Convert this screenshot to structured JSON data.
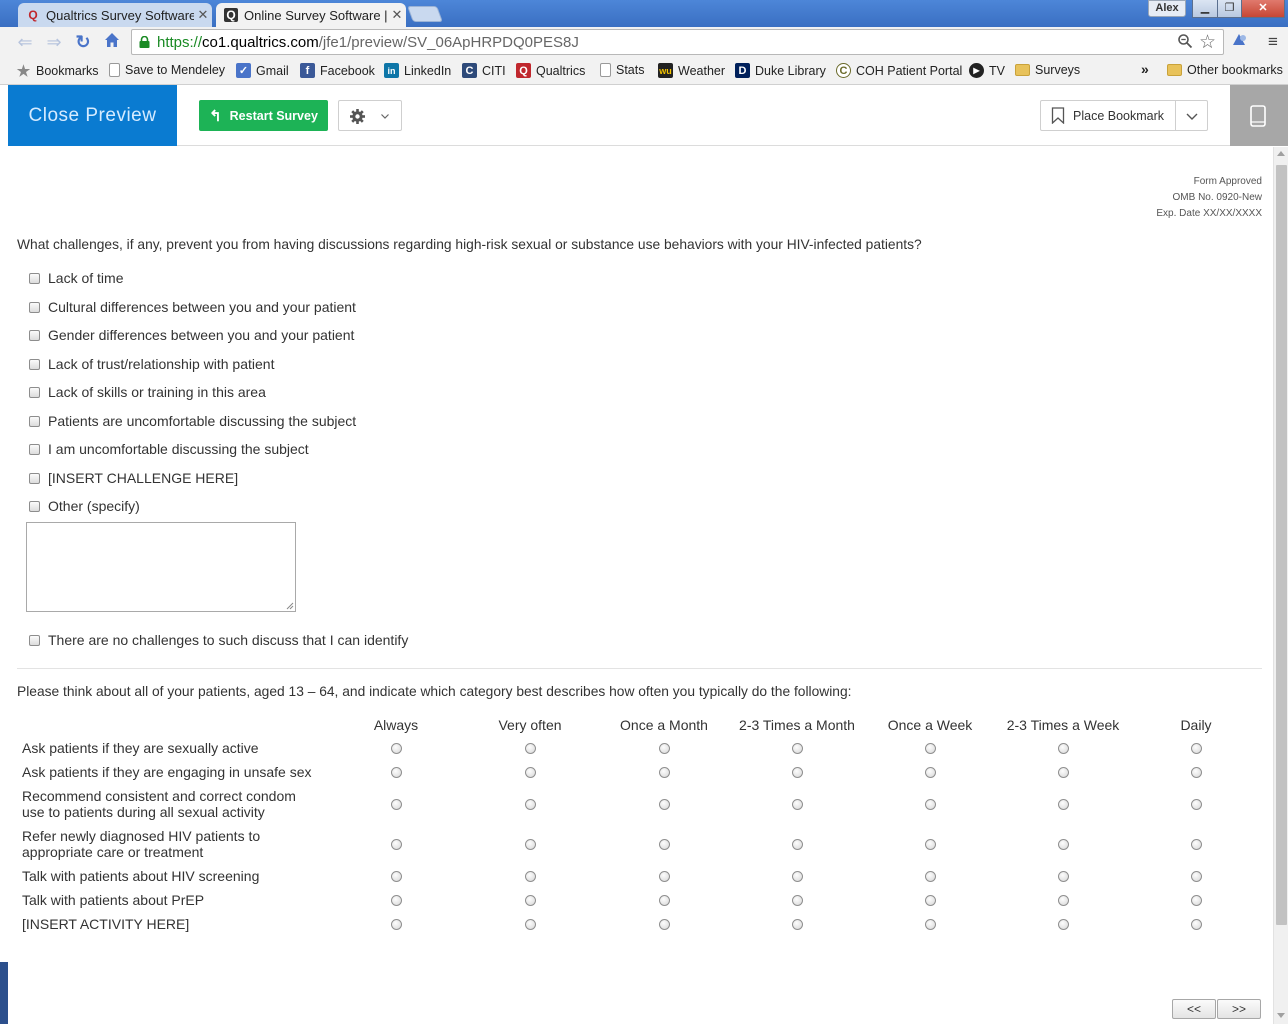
{
  "browser": {
    "tabs": [
      {
        "title": "Qualtrics Survey Software",
        "active": false
      },
      {
        "title": "Online Survey Software | C",
        "active": true
      }
    ],
    "user": "Alex",
    "url": {
      "scheme": "https://",
      "host": "co1.qualtrics.com",
      "path": "/jfe1/preview/SV_06ApHRPDQ0PES8J"
    },
    "bookmarks": [
      "Bookmarks",
      "Save to Mendeley",
      "Gmail",
      "Facebook",
      "LinkedIn",
      "CITI",
      "Qualtrics",
      "Stats",
      "Weather",
      "Duke Library",
      "COH Patient Portal",
      "TV",
      "Surveys"
    ],
    "other_bookmarks": "Other bookmarks",
    "overflow": "»"
  },
  "preview_bar": {
    "close_label": "Close Preview",
    "restart_label": "Restart Survey",
    "bookmark_label": "Place Bookmark"
  },
  "survey": {
    "form_note": [
      "Form Approved",
      "OMB No. 0920-New",
      "Exp. Date XX/XX/XXXX"
    ],
    "q1": {
      "text": "What challenges, if any, prevent you from having discussions regarding high-risk sexual or substance use behaviors with your HIV-infected patients?",
      "choices": [
        "Lack of time",
        "Cultural differences between you and your patient",
        "Gender differences between you and your patient",
        "Lack of trust/relationship with patient",
        "Lack of skills or training in this area",
        "Patients are uncomfortable discussing the subject",
        "I am uncomfortable discussing the subject",
        "[INSERT CHALLENGE HERE]",
        "Other (specify)"
      ],
      "other_value": "",
      "none_choice": "There are no challenges to such discuss that I can identify"
    },
    "q2": {
      "text": "Please think about all of your patients, aged 13 – 64, and indicate which category best describes how often you typically do the following:",
      "columns": [
        "Always",
        "Very often",
        "Once a Month",
        "2-3 Times a Month",
        "Once a Week",
        "2-3 Times a Week",
        "Daily"
      ],
      "rows": [
        [
          "Ask patients if they are sexually active"
        ],
        [
          "Ask patients if they are engaging in unsafe sex"
        ],
        [
          "Recommend consistent and correct condom",
          "use to patients during all sexual activity"
        ],
        [
          "Refer newly diagnosed HIV patients to",
          "appropriate care or treatment"
        ],
        [
          "Talk with patients about HIV screening"
        ],
        [
          "Talk with patients about PrEP"
        ],
        [
          "[INSERT ACTIVITY HERE]"
        ]
      ]
    },
    "nav": {
      "back": "<<",
      "next": ">>"
    }
  },
  "colors": {
    "close_preview_bg": "#0a7bd1",
    "restart_bg": "#1db356",
    "chrome_blue": "#4d86d8"
  }
}
